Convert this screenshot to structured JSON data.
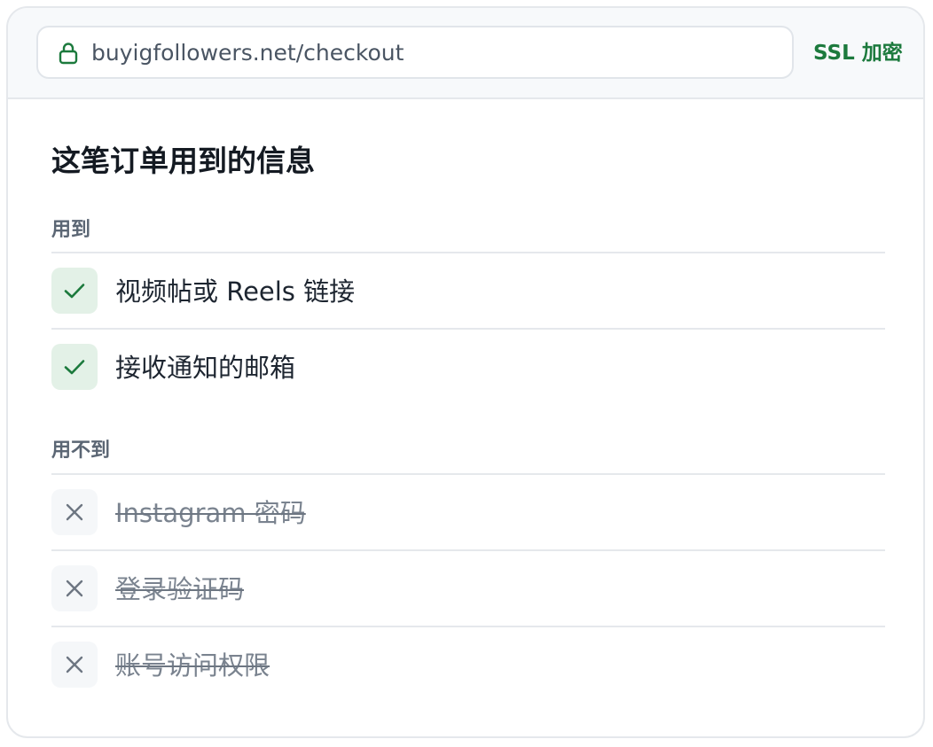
{
  "browser": {
    "url": "buyigfollowers.net/checkout",
    "security_label": "SSL 加密"
  },
  "main": {
    "title": "这笔订单用到的信息",
    "used": {
      "label": "用到",
      "items": [
        "视频帖或 Reels 链接",
        "接收通知的邮箱"
      ]
    },
    "not_used": {
      "label": "用不到",
      "items": [
        "Instagram 密码",
        "登录验证码",
        "账号访问权限"
      ]
    }
  },
  "colors": {
    "accent_green": "#1c7a3d",
    "check_bg": "#e3f1e7",
    "muted_gray": "#7a838f"
  },
  "icons": {
    "lock": "lock-icon",
    "check": "check-icon",
    "cross": "close-icon"
  }
}
